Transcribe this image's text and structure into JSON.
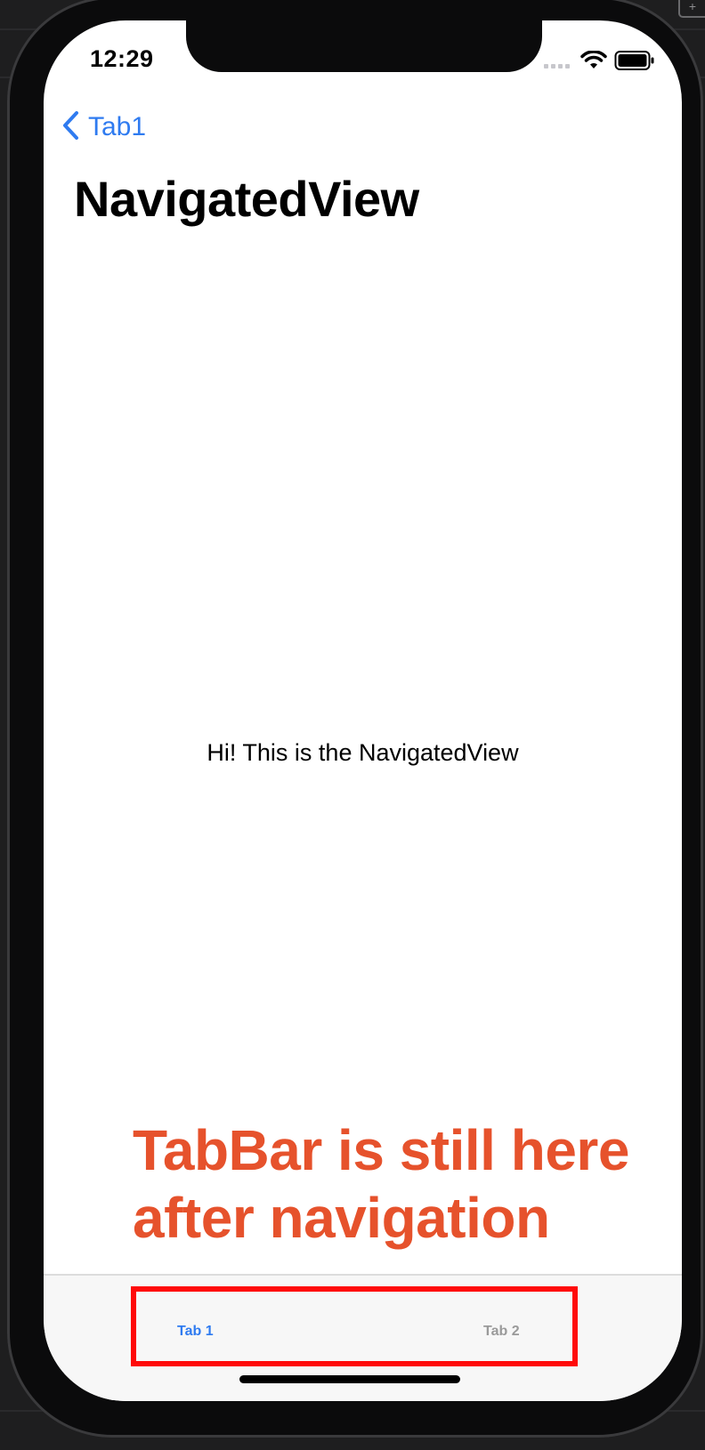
{
  "status_bar": {
    "time": "12:29",
    "icons": [
      "signal-icon",
      "wifi-icon",
      "battery-icon"
    ]
  },
  "navigation": {
    "back_label": "Tab1",
    "title": "NavigatedView"
  },
  "content": {
    "message": "Hi! This is the NavigatedView"
  },
  "annotation": {
    "line1": "TabBar is still here",
    "line2": "after navigation",
    "color": "#e6522c"
  },
  "tabbar": {
    "tabs": [
      {
        "label": "Tab 1",
        "selected": true
      },
      {
        "label": "Tab 2",
        "selected": false
      }
    ],
    "highlight_color": "#ff0a0a"
  },
  "colors": {
    "accent": "#2f7bf0",
    "inactive_tab": "#9a9a9a",
    "background": "#ffffff"
  }
}
